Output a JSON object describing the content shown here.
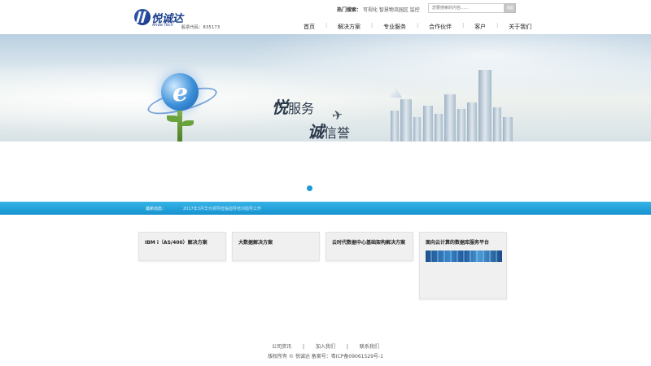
{
  "header": {
    "logo_cn": "悦诚达",
    "logo_en": "Anda Tech",
    "stock_code": "股票代码：835173",
    "hot_search_label": "热门搜索：",
    "hot_search_terms": "可视化 智慧物流园区 监控",
    "search_placeholder": "您要搜索的内容……",
    "search_button": "搜索"
  },
  "nav": {
    "items": [
      {
        "label": "首页"
      },
      {
        "label": "解决方案"
      },
      {
        "label": "专业服务"
      },
      {
        "label": "合作伙伴"
      },
      {
        "label": "客户"
      },
      {
        "label": "关于我们"
      }
    ]
  },
  "banner": {
    "slogan1_big": "悦",
    "slogan1_rest": "服务",
    "slogan2_big": "诚",
    "slogan2_rest": "信誉",
    "globe_letter": "e"
  },
  "news": {
    "label": "最新动态：",
    "text": "2017年3月华为领导莅临指导培训指导工作"
  },
  "cards": [
    {
      "title": "IBM i（AS/400）解决方案"
    },
    {
      "title": "大数据解决方案"
    },
    {
      "title": "云时代数据中心基础架构解决方案"
    },
    {
      "title": "面向云计算的数据库服务平台"
    }
  ],
  "footer": {
    "links": [
      "公司资讯",
      "加入我们",
      "联系我们"
    ],
    "separator": "|",
    "copyright": "版权所有 © 悦诚达 备案号：粤ICP备09061529号-1"
  },
  "colors": {
    "accent": "#1a9ad6",
    "news_bar": "#1693cf",
    "brand": "#1b3f8c"
  }
}
